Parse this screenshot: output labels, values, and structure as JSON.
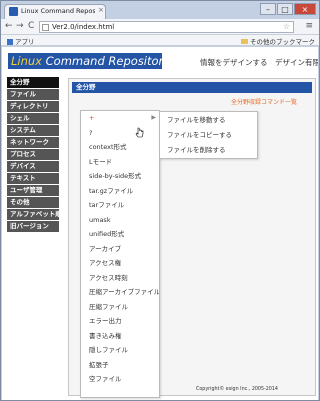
{
  "browser": {
    "tab_title": "Linux Command Reposi",
    "url": "Ver2.0/index.html",
    "nav_back": "←",
    "nav_forward": "→",
    "nav_reload": "C",
    "star": "☆",
    "menu": "≡",
    "apps_label": "アプリ",
    "other_bookmarks": "その他のブックマーク",
    "win_minimize": "–",
    "win_maximize": "□",
    "win_close": "×",
    "tab_close": "×"
  },
  "site": {
    "logo_linux": "Linux",
    "logo_rest": " Command Repository",
    "tagline": "情報をデザインする　デザイン有限会社"
  },
  "sidebar": {
    "items": [
      {
        "label": "全分野"
      },
      {
        "label": "ファイル"
      },
      {
        "label": "ディレクトリ"
      },
      {
        "label": "シェル"
      },
      {
        "label": "システム"
      },
      {
        "label": "ネットワーク"
      },
      {
        "label": "プロセス"
      },
      {
        "label": "デバイス"
      },
      {
        "label": "テキスト"
      },
      {
        "label": "ユーザ管理"
      },
      {
        "label": "その他"
      },
      {
        "label": "アルファベット順"
      },
      {
        "label": "旧バージョン"
      }
    ]
  },
  "main": {
    "heading": "全分野",
    "command_list_link": "全分野収録コマンド一覧",
    "dropdown": [
      {
        "label": "+"
      },
      {
        "label": "?"
      },
      {
        "label": "context形式"
      },
      {
        "label": "Lモード"
      },
      {
        "label": "side-by-side形式"
      },
      {
        "label": "tar.gzファイル"
      },
      {
        "label": "tarファイル"
      },
      {
        "label": "umask"
      },
      {
        "label": "unified形式"
      },
      {
        "label": "アーカイブ"
      },
      {
        "label": "アクセス権"
      },
      {
        "label": "アクセス時刻"
      },
      {
        "label": "圧縮アーカイブファイル"
      },
      {
        "label": "圧縮ファイル"
      },
      {
        "label": "エラー出力"
      },
      {
        "label": "書き込み権"
      },
      {
        "label": "隠しファイル"
      },
      {
        "label": "拡張子"
      },
      {
        "label": "空ファイル"
      }
    ],
    "submenu": [
      {
        "label": "ファイルを移動する"
      },
      {
        "label": "ファイルをコピーする"
      },
      {
        "label": "ファイルを削除する"
      }
    ]
  },
  "footer": {
    "copyright": "Copyright© esign Inc., 2005-2014"
  },
  "colors": {
    "brand_blue": "#2354a5",
    "logo_yellow": "#f3d23a",
    "accent_orange": "#e06a2c"
  }
}
